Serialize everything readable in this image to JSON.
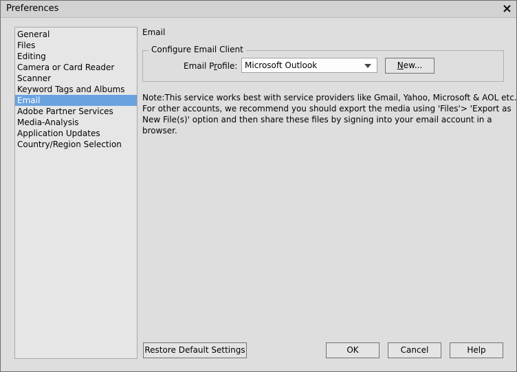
{
  "window": {
    "title": "Preferences",
    "close_icon": "close-icon"
  },
  "sidebar": {
    "items": [
      {
        "label": "General",
        "selected": false
      },
      {
        "label": "Files",
        "selected": false
      },
      {
        "label": "Editing",
        "selected": false
      },
      {
        "label": "Camera or Card Reader",
        "selected": false
      },
      {
        "label": "Scanner",
        "selected": false
      },
      {
        "label": "Keyword Tags and Albums",
        "selected": false
      },
      {
        "label": "Email",
        "selected": true
      },
      {
        "label": "Adobe Partner Services",
        "selected": false
      },
      {
        "label": "Media-Analysis",
        "selected": false
      },
      {
        "label": "Application Updates",
        "selected": false
      },
      {
        "label": "Country/Region Selection",
        "selected": false
      }
    ],
    "selected_color": "#6aa2e0"
  },
  "main": {
    "section_title": "Email",
    "group": {
      "legend": "Configure Email Client",
      "profile_label_pre": "Email P",
      "profile_label_accel": "r",
      "profile_label_post": "ofile:",
      "profile_value": "Microsoft Outlook",
      "new_button_accel": "N",
      "new_button_rest": "ew..."
    },
    "note_lines": [
      "Note:This service works best with service providers like Gmail, Yahoo, Microsoft & AOL etc.",
      "For other accounts, we recommend you should export the media using 'Files'> 'Export as",
      "New File(s)' option and then share these files by signing into your email account in a",
      "browser."
    ]
  },
  "footer": {
    "restore_label": "Restore Default Settings",
    "ok_label": "OK",
    "cancel_label": "Cancel",
    "help_label": "Help"
  }
}
